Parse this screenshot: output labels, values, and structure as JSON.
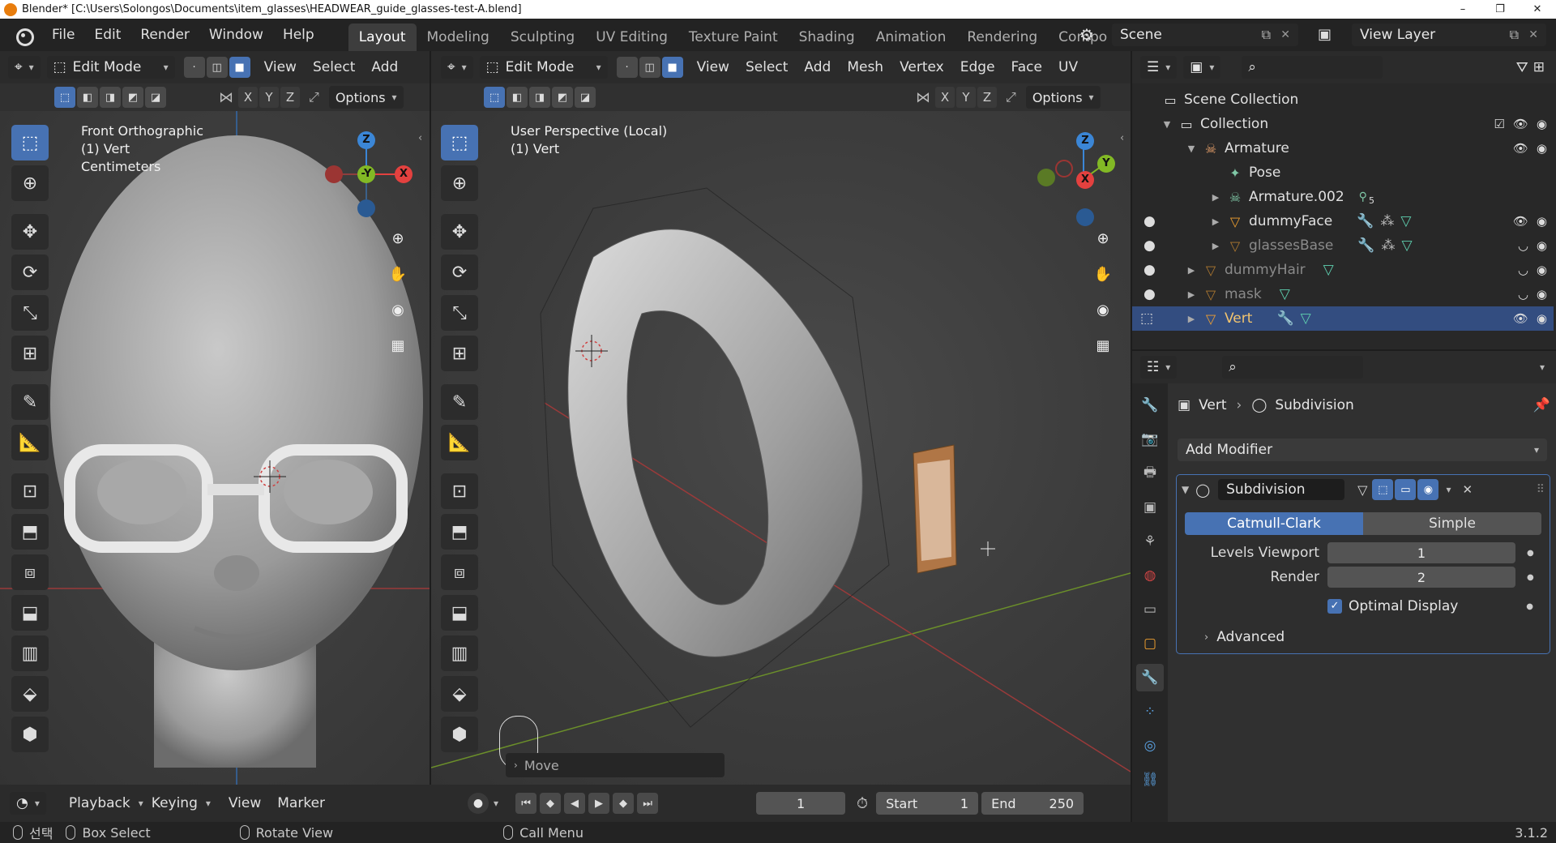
{
  "window": {
    "title": "Blender* [C:\\Users\\Solongos\\Documents\\item_glasses\\HEADWEAR_guide_glasses-test-A.blend]",
    "minimize": "–",
    "maximize": "❐",
    "close": "✕"
  },
  "menu": [
    "File",
    "Edit",
    "Render",
    "Window",
    "Help"
  ],
  "workspaces": [
    "Layout",
    "Modeling",
    "Sculpting",
    "UV Editing",
    "Texture Paint",
    "Shading",
    "Animation",
    "Rendering",
    "Compo"
  ],
  "scene": {
    "name": "Scene",
    "view_layer": "View Layer"
  },
  "left_viewport": {
    "mode": "Edit Mode",
    "menus": [
      "View",
      "Select",
      "Add"
    ],
    "axes": [
      "X",
      "Y",
      "Z"
    ],
    "options": "Options",
    "overlay": [
      "Front Orthographic",
      "(1) Vert",
      "Centimeters"
    ],
    "gizmo": {
      "z": "Z",
      "y": "-Y",
      "x": "X"
    }
  },
  "right_viewport": {
    "mode": "Edit Mode",
    "menus": [
      "View",
      "Select",
      "Add",
      "Mesh",
      "Vertex",
      "Edge",
      "Face",
      "UV"
    ],
    "axes": [
      "X",
      "Y",
      "Z"
    ],
    "options": "Options",
    "overlay": [
      "User Perspective (Local)",
      "(1) Vert"
    ],
    "gizmo": {
      "z": "Z",
      "y": "Y",
      "x": "X"
    },
    "operator_panel": "Move"
  },
  "outliner": {
    "rows": [
      {
        "label": "Scene Collection",
        "icon": "scene-collection-icon"
      },
      {
        "label": "Collection",
        "icon": "collection-icon"
      },
      {
        "label": "Armature",
        "icon": "armature-icon"
      },
      {
        "label": "Pose",
        "icon": "pose-icon"
      },
      {
        "label": "Armature.002",
        "icon": "armature-data-icon",
        "badge": "5"
      },
      {
        "label": "dummyFace",
        "icon": "mesh-icon"
      },
      {
        "label": "glassesBase",
        "icon": "mesh-icon"
      },
      {
        "label": "dummyHair",
        "icon": "mesh-icon"
      },
      {
        "label": "mask",
        "icon": "mesh-icon"
      },
      {
        "label": "Vert",
        "icon": "mesh-icon"
      }
    ]
  },
  "properties": {
    "breadcrumb_object": "Vert",
    "breadcrumb_modifier": "Subdivision",
    "add_modifier": "Add Modifier",
    "modifier_name": "Subdivision",
    "algo_options": [
      "Catmull-Clark",
      "Simple"
    ],
    "levels_viewport_label": "Levels Viewport",
    "levels_viewport_value": "1",
    "render_label": "Render",
    "render_value": "2",
    "optimal_display": "Optimal Display",
    "advanced": "Advanced"
  },
  "timeline": {
    "menus": [
      "Playback",
      "Keying",
      "View",
      "Marker"
    ],
    "current_frame": "1",
    "start_label": "Start",
    "start_value": "1",
    "end_label": "End",
    "end_value": "250"
  },
  "statusbar": {
    "select": "선택",
    "box_select": "Box Select",
    "rotate_view": "Rotate View",
    "call_menu": "Call Menu",
    "version": "3.1.2"
  },
  "colors": {
    "accent": "#4772b3",
    "selected_row": "#334d80",
    "axis_x": "#e3413f",
    "axis_y": "#82b925",
    "axis_z": "#3b86d6"
  }
}
